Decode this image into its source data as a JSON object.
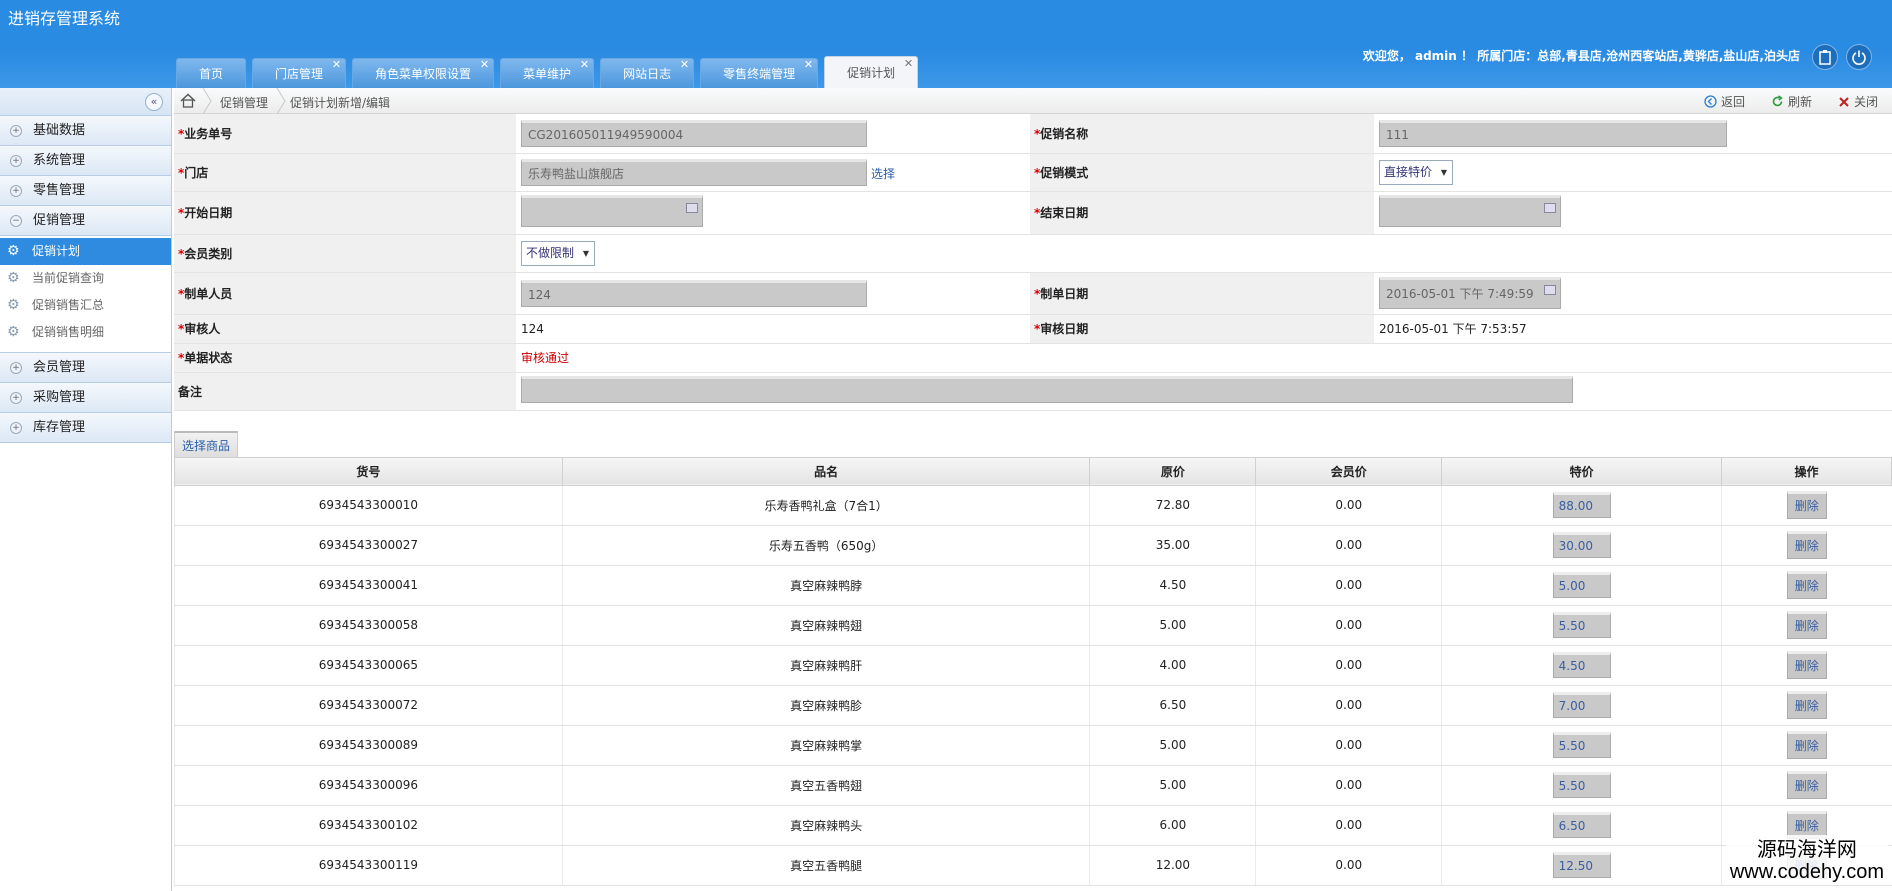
{
  "app_title": "进销存管理系统",
  "welcome": "欢迎您， admin ！ 所属门店：总部,青县店,沧州西客站店,黄骅店,盐山店,泊头店",
  "tabs": [
    {
      "label": "首页",
      "closable": false
    },
    {
      "label": "门店管理",
      "closable": true
    },
    {
      "label": "角色菜单权限设置",
      "closable": true
    },
    {
      "label": "菜单维护",
      "closable": true
    },
    {
      "label": "网站日志",
      "closable": true
    },
    {
      "label": "零售终端管理",
      "closable": true
    },
    {
      "label": "促销计划",
      "closable": true,
      "active": true
    }
  ],
  "sidebar": {
    "groups_top": [
      "基础数据",
      "系统管理",
      "零售管理"
    ],
    "open_group": "促销管理",
    "sub_items": [
      "促销计划",
      "当前促销查询",
      "促销销售汇总",
      "促销销售明细"
    ],
    "groups_bottom": [
      "会员管理",
      "采购管理",
      "库存管理"
    ]
  },
  "breadcrumb": {
    "level1": "促销管理",
    "level2": "促销计划新增/编辑"
  },
  "actions": {
    "back": "返回",
    "refresh": "刷新",
    "close": "关闭"
  },
  "form": {
    "doc_no_label": "业务单号",
    "doc_no": "CG201605011949590004",
    "promo_name_label": "促销名称",
    "promo_name": "111",
    "store_label": "门店",
    "store": "乐寿鸭盐山旗舰店",
    "select_link": "选择",
    "promo_mode_label": "促销模式",
    "promo_mode": "直接特价",
    "start_date_label": "开始日期",
    "start_date": "",
    "end_date_label": "结束日期",
    "end_date": "",
    "member_type_label": "会员类别",
    "member_type": "不做限制",
    "creator_label": "制单人员",
    "creator": "124",
    "create_date_label": "制单日期",
    "create_date": "2016-05-01 下午 7:49:59",
    "auditor_label": "审核人",
    "auditor": "124",
    "audit_date_label": "审核日期",
    "audit_date": "2016-05-01 下午 7:53:57",
    "status_label": "单据状态",
    "status": "审核通过",
    "remark_label": "备注",
    "remark": ""
  },
  "pick_goods": "选择商品",
  "table": {
    "headers": [
      "货号",
      "品名",
      "原价",
      "会员价",
      "特价",
      "操作"
    ],
    "delete_label": "删除",
    "rows": [
      {
        "code": "6934543300010",
        "name": "乐寿香鸭礼盒（7合1）",
        "price": "72.80",
        "member": "0.00",
        "special": "88.00"
      },
      {
        "code": "6934543300027",
        "name": "乐寿五香鸭（650g）",
        "price": "35.00",
        "member": "0.00",
        "special": "30.00"
      },
      {
        "code": "6934543300041",
        "name": "真空麻辣鸭脖",
        "price": "4.50",
        "member": "0.00",
        "special": "5.00"
      },
      {
        "code": "6934543300058",
        "name": "真空麻辣鸭翅",
        "price": "5.00",
        "member": "0.00",
        "special": "5.50"
      },
      {
        "code": "6934543300065",
        "name": "真空麻辣鸭肝",
        "price": "4.00",
        "member": "0.00",
        "special": "4.50"
      },
      {
        "code": "6934543300072",
        "name": "真空麻辣鸭胗",
        "price": "6.50",
        "member": "0.00",
        "special": "7.00"
      },
      {
        "code": "6934543300089",
        "name": "真空麻辣鸭掌",
        "price": "5.00",
        "member": "0.00",
        "special": "5.50"
      },
      {
        "code": "6934543300096",
        "name": "真空五香鸭翅",
        "price": "5.00",
        "member": "0.00",
        "special": "5.50"
      },
      {
        "code": "6934543300102",
        "name": "真空麻辣鸭头",
        "price": "6.00",
        "member": "0.00",
        "special": "6.50"
      },
      {
        "code": "6934543300119",
        "name": "真空五香鸭腿",
        "price": "12.00",
        "member": "0.00",
        "special": "12.50"
      }
    ]
  },
  "watermark": {
    "line1": "源码海洋网",
    "line2": "www.codehy.com"
  }
}
